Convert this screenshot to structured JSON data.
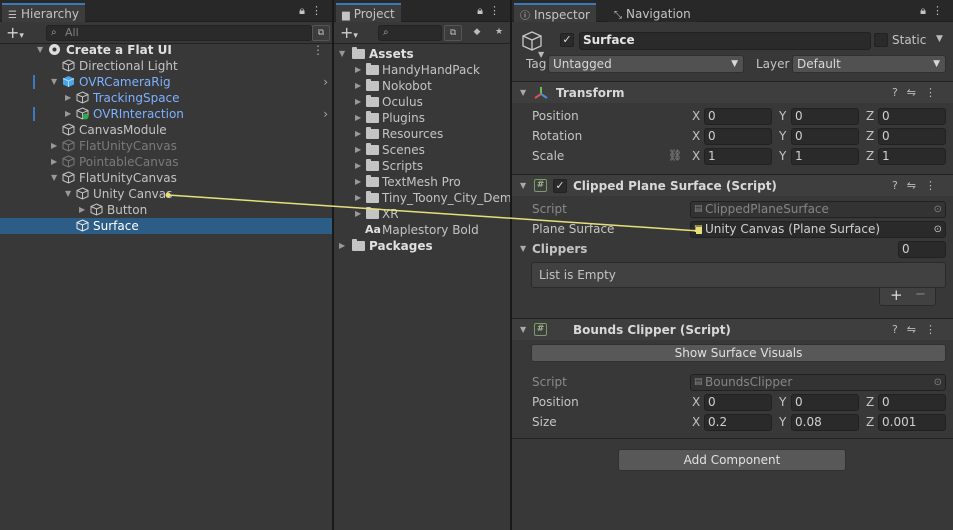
{
  "hierarchy": {
    "tab_label": "Hierarchy",
    "search_placeholder": "All",
    "scene": "Create a Flat UI",
    "items": [
      {
        "label": "Directional Light"
      },
      {
        "label": "OVRCameraRig"
      },
      {
        "label": "TrackingSpace"
      },
      {
        "label": "OVRInteraction"
      },
      {
        "label": "CanvasModule"
      },
      {
        "label": "FlatUnityCanvas"
      },
      {
        "label": "PointableCanvas"
      },
      {
        "label": "FlatUnityCanvas"
      },
      {
        "label": "Unity Canvas"
      },
      {
        "label": "Button"
      },
      {
        "label": "Surface"
      }
    ]
  },
  "project": {
    "tab_label": "Project",
    "root": "Assets",
    "folders": [
      {
        "label": "HandyHandPack"
      },
      {
        "label": "Nokobot"
      },
      {
        "label": "Oculus"
      },
      {
        "label": "Plugins"
      },
      {
        "label": "Resources"
      },
      {
        "label": "Scenes"
      },
      {
        "label": "Scripts"
      },
      {
        "label": "TextMesh Pro"
      },
      {
        "label": "Tiny_Toony_City_Demo"
      },
      {
        "label": "XR"
      }
    ],
    "font_asset": "Maplestory Bold",
    "font_asset_prefix": "Aa",
    "packages": "Packages"
  },
  "inspector": {
    "tab_label": "Inspector",
    "nav_tab_label": "Navigation",
    "object_name": "Surface",
    "static_label": "Static",
    "tag_label": "Tag",
    "tag_value": "Untagged",
    "layer_label": "Layer",
    "layer_value": "Default",
    "transform": {
      "title": "Transform",
      "position_label": "Position",
      "rotation_label": "Rotation",
      "scale_label": "Scale",
      "position": {
        "x": "0",
        "y": "0",
        "z": "0"
      },
      "rotation": {
        "x": "0",
        "y": "0",
        "z": "0"
      },
      "scale": {
        "x": "1",
        "y": "1",
        "z": "1"
      }
    },
    "clipped": {
      "title": "Clipped Plane Surface (Script)",
      "script_label": "Script",
      "script_value": "ClippedPlaneSurface",
      "plane_label": "Plane Surface",
      "plane_value": "Unity Canvas (Plane Surface)",
      "clippers_label": "Clippers",
      "clippers_count": "0",
      "list_empty": "List is Empty",
      "add": "+",
      "remove": "−"
    },
    "bounds": {
      "title": "Bounds Clipper (Script)",
      "show_button": "Show Surface Visuals",
      "script_label": "Script",
      "script_value": "BoundsClipper",
      "position_label": "Position",
      "size_label": "Size",
      "position": {
        "x": "0",
        "y": "0",
        "z": "0"
      },
      "size": {
        "x": "0.2",
        "y": "0.08",
        "z": "0.001"
      }
    },
    "add_component": "Add Component"
  },
  "axis_labels": {
    "x": "X",
    "y": "Y",
    "z": "Z"
  }
}
